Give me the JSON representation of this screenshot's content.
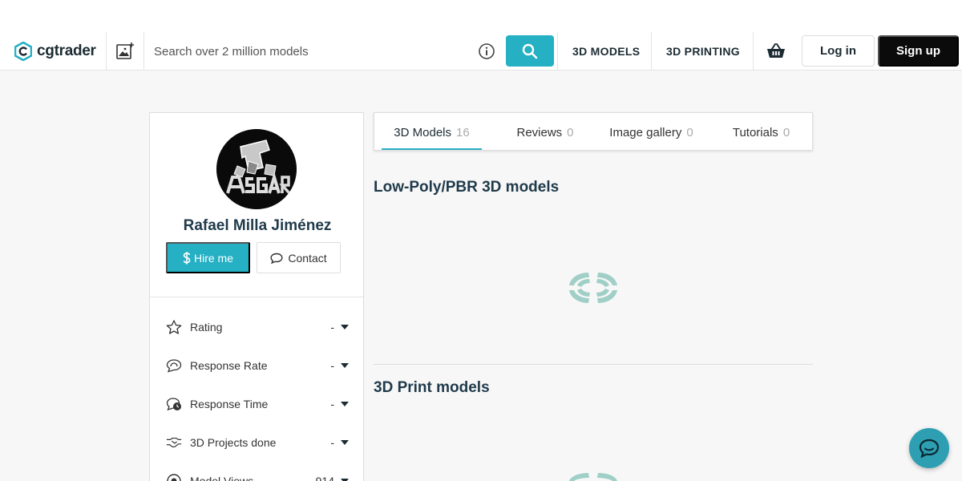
{
  "header": {
    "logo_text": "cgtrader",
    "search_placeholder": "Search over 2 million models",
    "nav": [
      {
        "label": "3D MODELS"
      },
      {
        "label": "3D PRINTING"
      }
    ],
    "login_label": "Log in",
    "signup_label": "Sign up"
  },
  "profile": {
    "name": "Rafael Milla Jiménez",
    "hire_label": "Hire me",
    "contact_label": "Contact",
    "stats": [
      {
        "label": "Rating",
        "value": "-",
        "icon": "star-icon"
      },
      {
        "label": "Response Rate",
        "value": "-",
        "icon": "chat-bubble-icon"
      },
      {
        "label": "Response Time",
        "value": "-",
        "icon": "clock-bubble-icon"
      },
      {
        "label": "3D Projects done",
        "value": "-",
        "icon": "handshake-icon"
      },
      {
        "label": "Model Views",
        "value": "914",
        "icon": "eye-icon"
      }
    ]
  },
  "tabs": [
    {
      "label": "3D Models",
      "count": "16"
    },
    {
      "label": "Reviews",
      "count": "0"
    },
    {
      "label": "Image gallery",
      "count": "0"
    },
    {
      "label": "Tutorials",
      "count": "0"
    }
  ],
  "sections": [
    {
      "title": "Low-Poly/PBR 3D models"
    },
    {
      "title": "3D Print models"
    }
  ],
  "colors": {
    "accent": "#25b0c4",
    "dark": "#0b0b0b",
    "heading": "#1f3a4a"
  }
}
